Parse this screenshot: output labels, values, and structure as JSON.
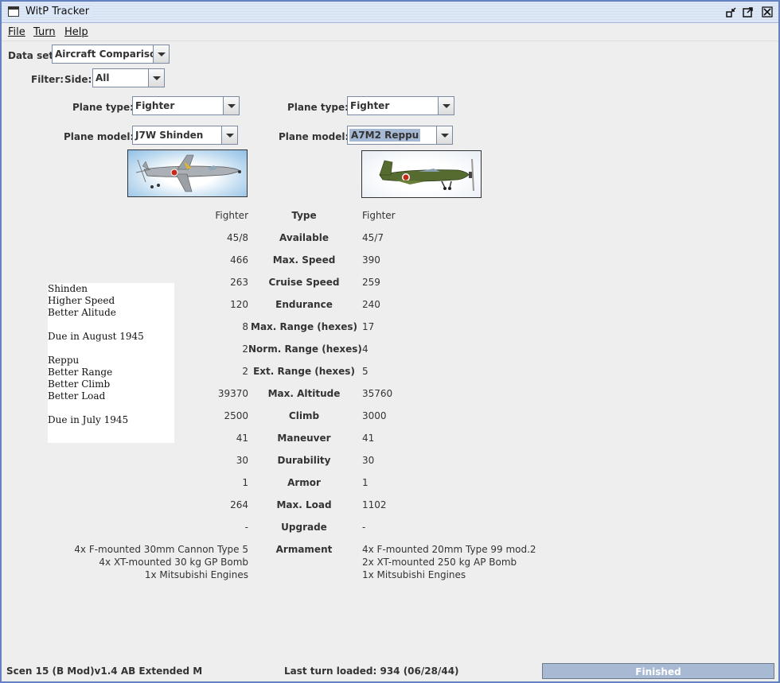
{
  "window": {
    "title": "WitP Tracker"
  },
  "menu": {
    "file": "File",
    "turn": "Turn",
    "help": "Help"
  },
  "dataset": {
    "label": "Data set:",
    "value": "Aircraft Comparison"
  },
  "filter": {
    "label": "Filter:",
    "side_label": "Side:",
    "side_value": "All"
  },
  "left": {
    "plane_type_label": "Plane type:",
    "plane_type": "Fighter",
    "plane_model_label": "Plane model:",
    "plane_model": "J7W Shinden"
  },
  "right": {
    "plane_type_label": "Plane type:",
    "plane_type": "Fighter",
    "plane_model_label": "Plane model:",
    "plane_model": "A7M2 Reppu"
  },
  "notes": [
    "Shinden",
    "Higher Speed",
    "Better Alitude",
    "",
    "Due in August 1945",
    "",
    "Reppu",
    "Better Range",
    "Better Climb",
    "Better Load",
    "",
    "Due in July 1945"
  ],
  "rows": [
    {
      "left": "Fighter",
      "label": "Type",
      "right": "Fighter"
    },
    {
      "left": "45/8",
      "label": "Available",
      "right": "45/7"
    },
    {
      "left": "466",
      "label": "Max. Speed",
      "right": "390"
    },
    {
      "left": "263",
      "label": "Cruise Speed",
      "right": "259"
    },
    {
      "left": "120",
      "label": "Endurance",
      "right": "240"
    },
    {
      "left": "8",
      "label": "Max. Range (hexes)",
      "right": "17"
    },
    {
      "left": "2",
      "label": "Norm. Range (hexes)",
      "right": "4"
    },
    {
      "left": "2",
      "label": "Ext. Range (hexes)",
      "right": "5"
    },
    {
      "left": "39370",
      "label": "Max. Altitude",
      "right": "35760"
    },
    {
      "left": "2500",
      "label": "Climb",
      "right": "3000"
    },
    {
      "left": "41",
      "label": "Maneuver",
      "right": "41"
    },
    {
      "left": "30",
      "label": "Durability",
      "right": "30"
    },
    {
      "left": "1",
      "label": "Armor",
      "right": "1"
    },
    {
      "left": "264",
      "label": "Max. Load",
      "right": "1102"
    },
    {
      "left": "-",
      "label": "Upgrade",
      "right": "-"
    }
  ],
  "armament": {
    "label": "Armament",
    "left": [
      "4x F-mounted 30mm Cannon Type 5",
      "4x XT-mounted 30 kg GP Bomb",
      "1x Mitsubishi Engines"
    ],
    "right": [
      "4x F-mounted 20mm Type 99 mod.2",
      "2x XT-mounted 250 kg AP Bomb",
      "1x Mitsubishi Engines"
    ]
  },
  "status": {
    "scenario": "Scen 15 (B Mod)v1.4 AB Extended M",
    "last_turn": "Last turn loaded: 934 (06/28/44)",
    "progress_text": "Finished",
    "progress": 1.0
  },
  "colors": {
    "window_border": "#6382bf",
    "background": "#eeeeee",
    "progress": "#a8bad3"
  }
}
